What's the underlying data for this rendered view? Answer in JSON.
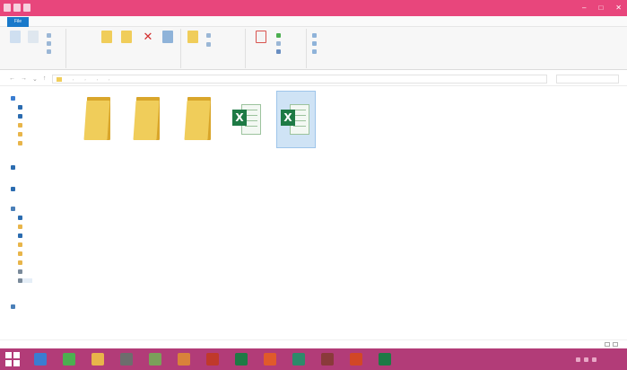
{
  "window": {
    "title": "",
    "accent": "#e8467c"
  },
  "ribbon_tabs": [
    {
      "label": "File"
    },
    {
      "label": ""
    },
    {
      "label": ""
    },
    {
      "label": ""
    }
  ],
  "ribbon_groups": [
    {
      "label": ""
    },
    {
      "label": ""
    },
    {
      "label": ""
    },
    {
      "label": ""
    },
    {
      "label": ""
    }
  ],
  "address": {
    "crumbs": [
      "",
      "",
      "",
      "",
      ""
    ],
    "search_placeholder": ""
  },
  "nav": {
    "quick_access": "",
    "quick_items": [
      "",
      "",
      "",
      ""
    ],
    "onedrive": "",
    "homegroup": "",
    "this_pc": "",
    "pc_items": [
      "",
      "",
      "",
      "",
      "",
      "",
      "",
      ""
    ],
    "network": ""
  },
  "files": [
    {
      "name": "",
      "type": "folder"
    },
    {
      "name": "",
      "type": "folder"
    },
    {
      "name": "",
      "type": "folder"
    },
    {
      "name": "",
      "type": "excel",
      "icon": "excel-icon"
    },
    {
      "name": "",
      "type": "excel",
      "icon": "excel-icon",
      "selected": true
    }
  ],
  "status": {
    "text": ""
  },
  "taskbar": {
    "color": "#b23c78",
    "apps": [
      {
        "icon": "file-explorer-icon",
        "color": "#3a7dd1"
      },
      {
        "icon": "chrome-icon",
        "color": "#4caf50"
      },
      {
        "icon": "folder-icon",
        "color": "#e8b54a"
      },
      {
        "icon": "media-icon",
        "color": "#6d6d6d"
      },
      {
        "icon": "app-icon",
        "color": "#7aa05a"
      },
      {
        "icon": "app-icon",
        "color": "#d9823a"
      },
      {
        "icon": "app-icon",
        "color": "#c0392b"
      },
      {
        "icon": "excel-icon",
        "color": "#1e7a45"
      },
      {
        "icon": "app-icon",
        "color": "#e05a2b"
      },
      {
        "icon": "app-icon",
        "color": "#2d8a6a"
      },
      {
        "icon": "app-icon",
        "color": "#8a3a3a"
      },
      {
        "icon": "powerpoint-icon",
        "color": "#d24726"
      },
      {
        "icon": "excel-icon",
        "color": "#1e7a45"
      }
    ],
    "time": "",
    "date": ""
  }
}
